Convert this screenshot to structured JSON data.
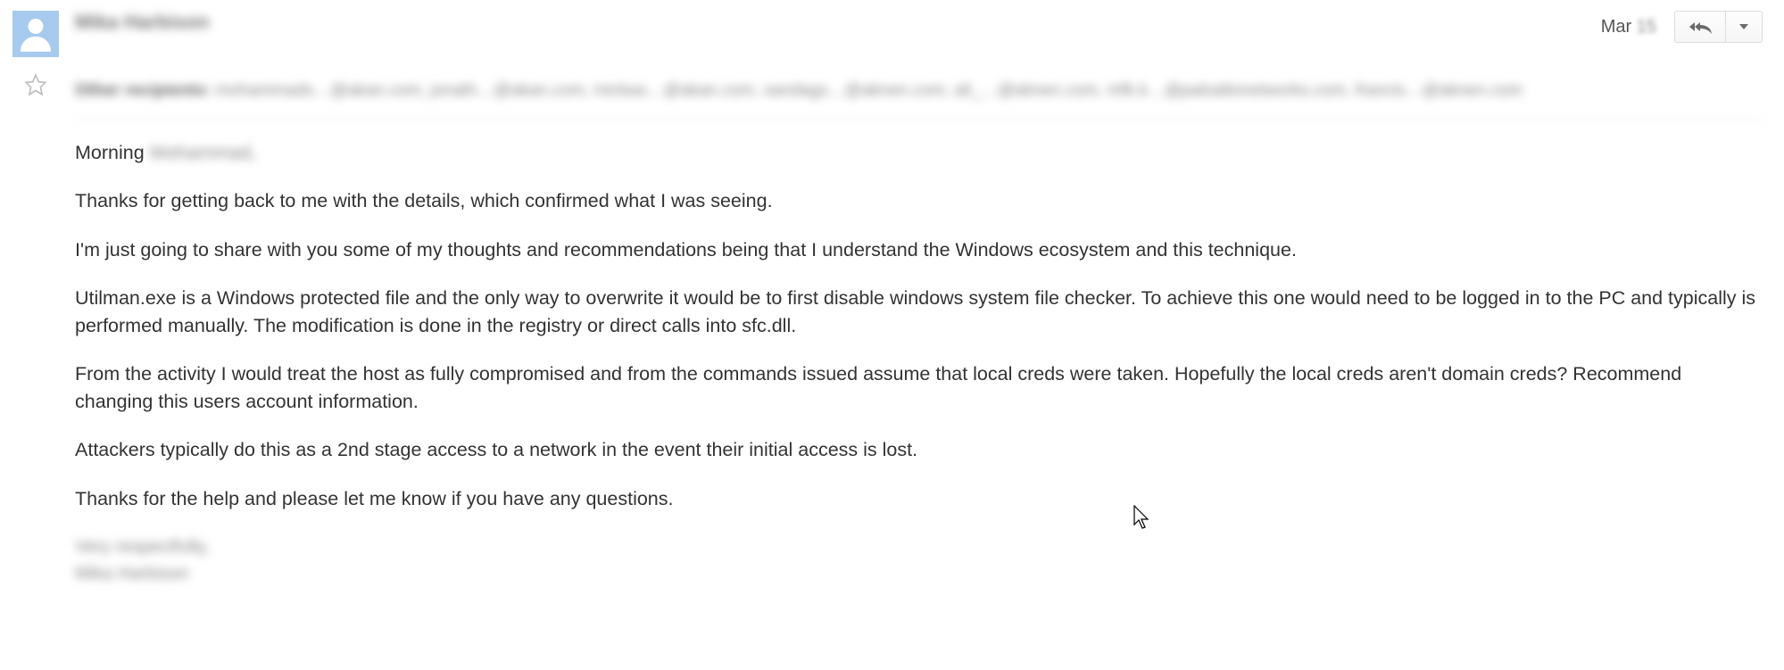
{
  "header": {
    "sender_name": "Mika Harbison",
    "date_prefix": "Mar ",
    "date_day": "15"
  },
  "recipients": {
    "label": "Other recipients:",
    "list": "mohammads…@akan.com, jonath…@akan.com, mickas…@akan.com, sandags…@aknen.com, all_…@aknen.com, mfk.k…@paloaltonetworks.com, francis…@aknen.com"
  },
  "body": {
    "greeting_prefix": "Morning ",
    "greeting_name": "Mohammad,",
    "p1": "Thanks for getting back to me with the details, which confirmed what I was seeing.",
    "p2": "I'm just going to share with you some of my thoughts and recommendations being that I understand the Windows ecosystem and this technique.",
    "p3": "Utilman.exe is a Windows protected file and the only way to overwrite it would be to first disable windows system file checker.  To achieve this one would need to be logged in to the PC and typically is performed manually.  The modification is done in the registry or direct calls into sfc.dll.",
    "p4": "From the activity I would treat the host as fully compromised and from the commands issued assume that local creds were taken.  Hopefully the local creds aren't domain creds?  Recommend changing this users account information.",
    "p5": "Attackers typically do this as a 2nd stage access to a network in the event their initial access is lost.",
    "p6": "Thanks for the help and please let me know if you have any questions."
  },
  "signature": {
    "line1": "Very respectfully,",
    "line2": "Mika Harbison"
  }
}
